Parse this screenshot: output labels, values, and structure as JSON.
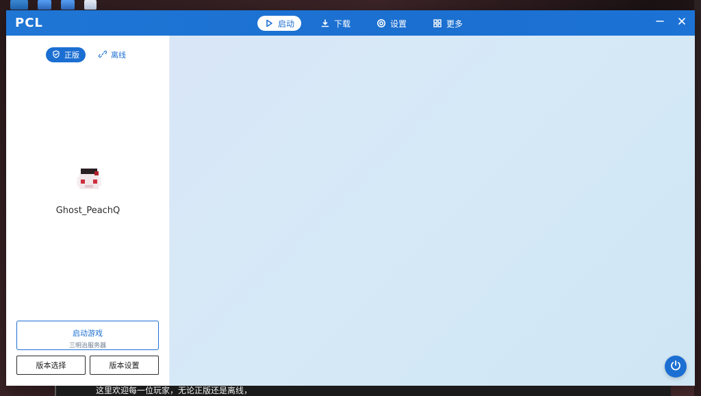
{
  "app": {
    "title": "PCL"
  },
  "nav": {
    "items": [
      {
        "label": "启动",
        "icon": "play-icon",
        "active": true
      },
      {
        "label": "下载",
        "icon": "download-icon",
        "active": false
      },
      {
        "label": "设置",
        "icon": "settings-icon",
        "active": false
      },
      {
        "label": "更多",
        "icon": "grid-icon",
        "active": false
      }
    ]
  },
  "window_controls": {
    "minimize_icon": "minimize-icon",
    "close_icon": "close-icon"
  },
  "account": {
    "modes": [
      {
        "label": "正版",
        "icon": "shield-check-icon",
        "active": true
      },
      {
        "label": "离线",
        "icon": "link-icon",
        "active": false
      }
    ],
    "username": "Ghost_PeachQ"
  },
  "actions": {
    "launch_title": "启动游戏",
    "launch_subtitle": "三明治服务器",
    "version_select": "版本选择",
    "version_settings": "版本设置"
  },
  "background": {
    "underlay_text": "这里欢迎每一位玩家，无论正版还是离线，"
  },
  "colors": {
    "accent": "#1C6FD2",
    "titlebar": "#1F76D5",
    "right_panel": "#D6E9F7"
  }
}
